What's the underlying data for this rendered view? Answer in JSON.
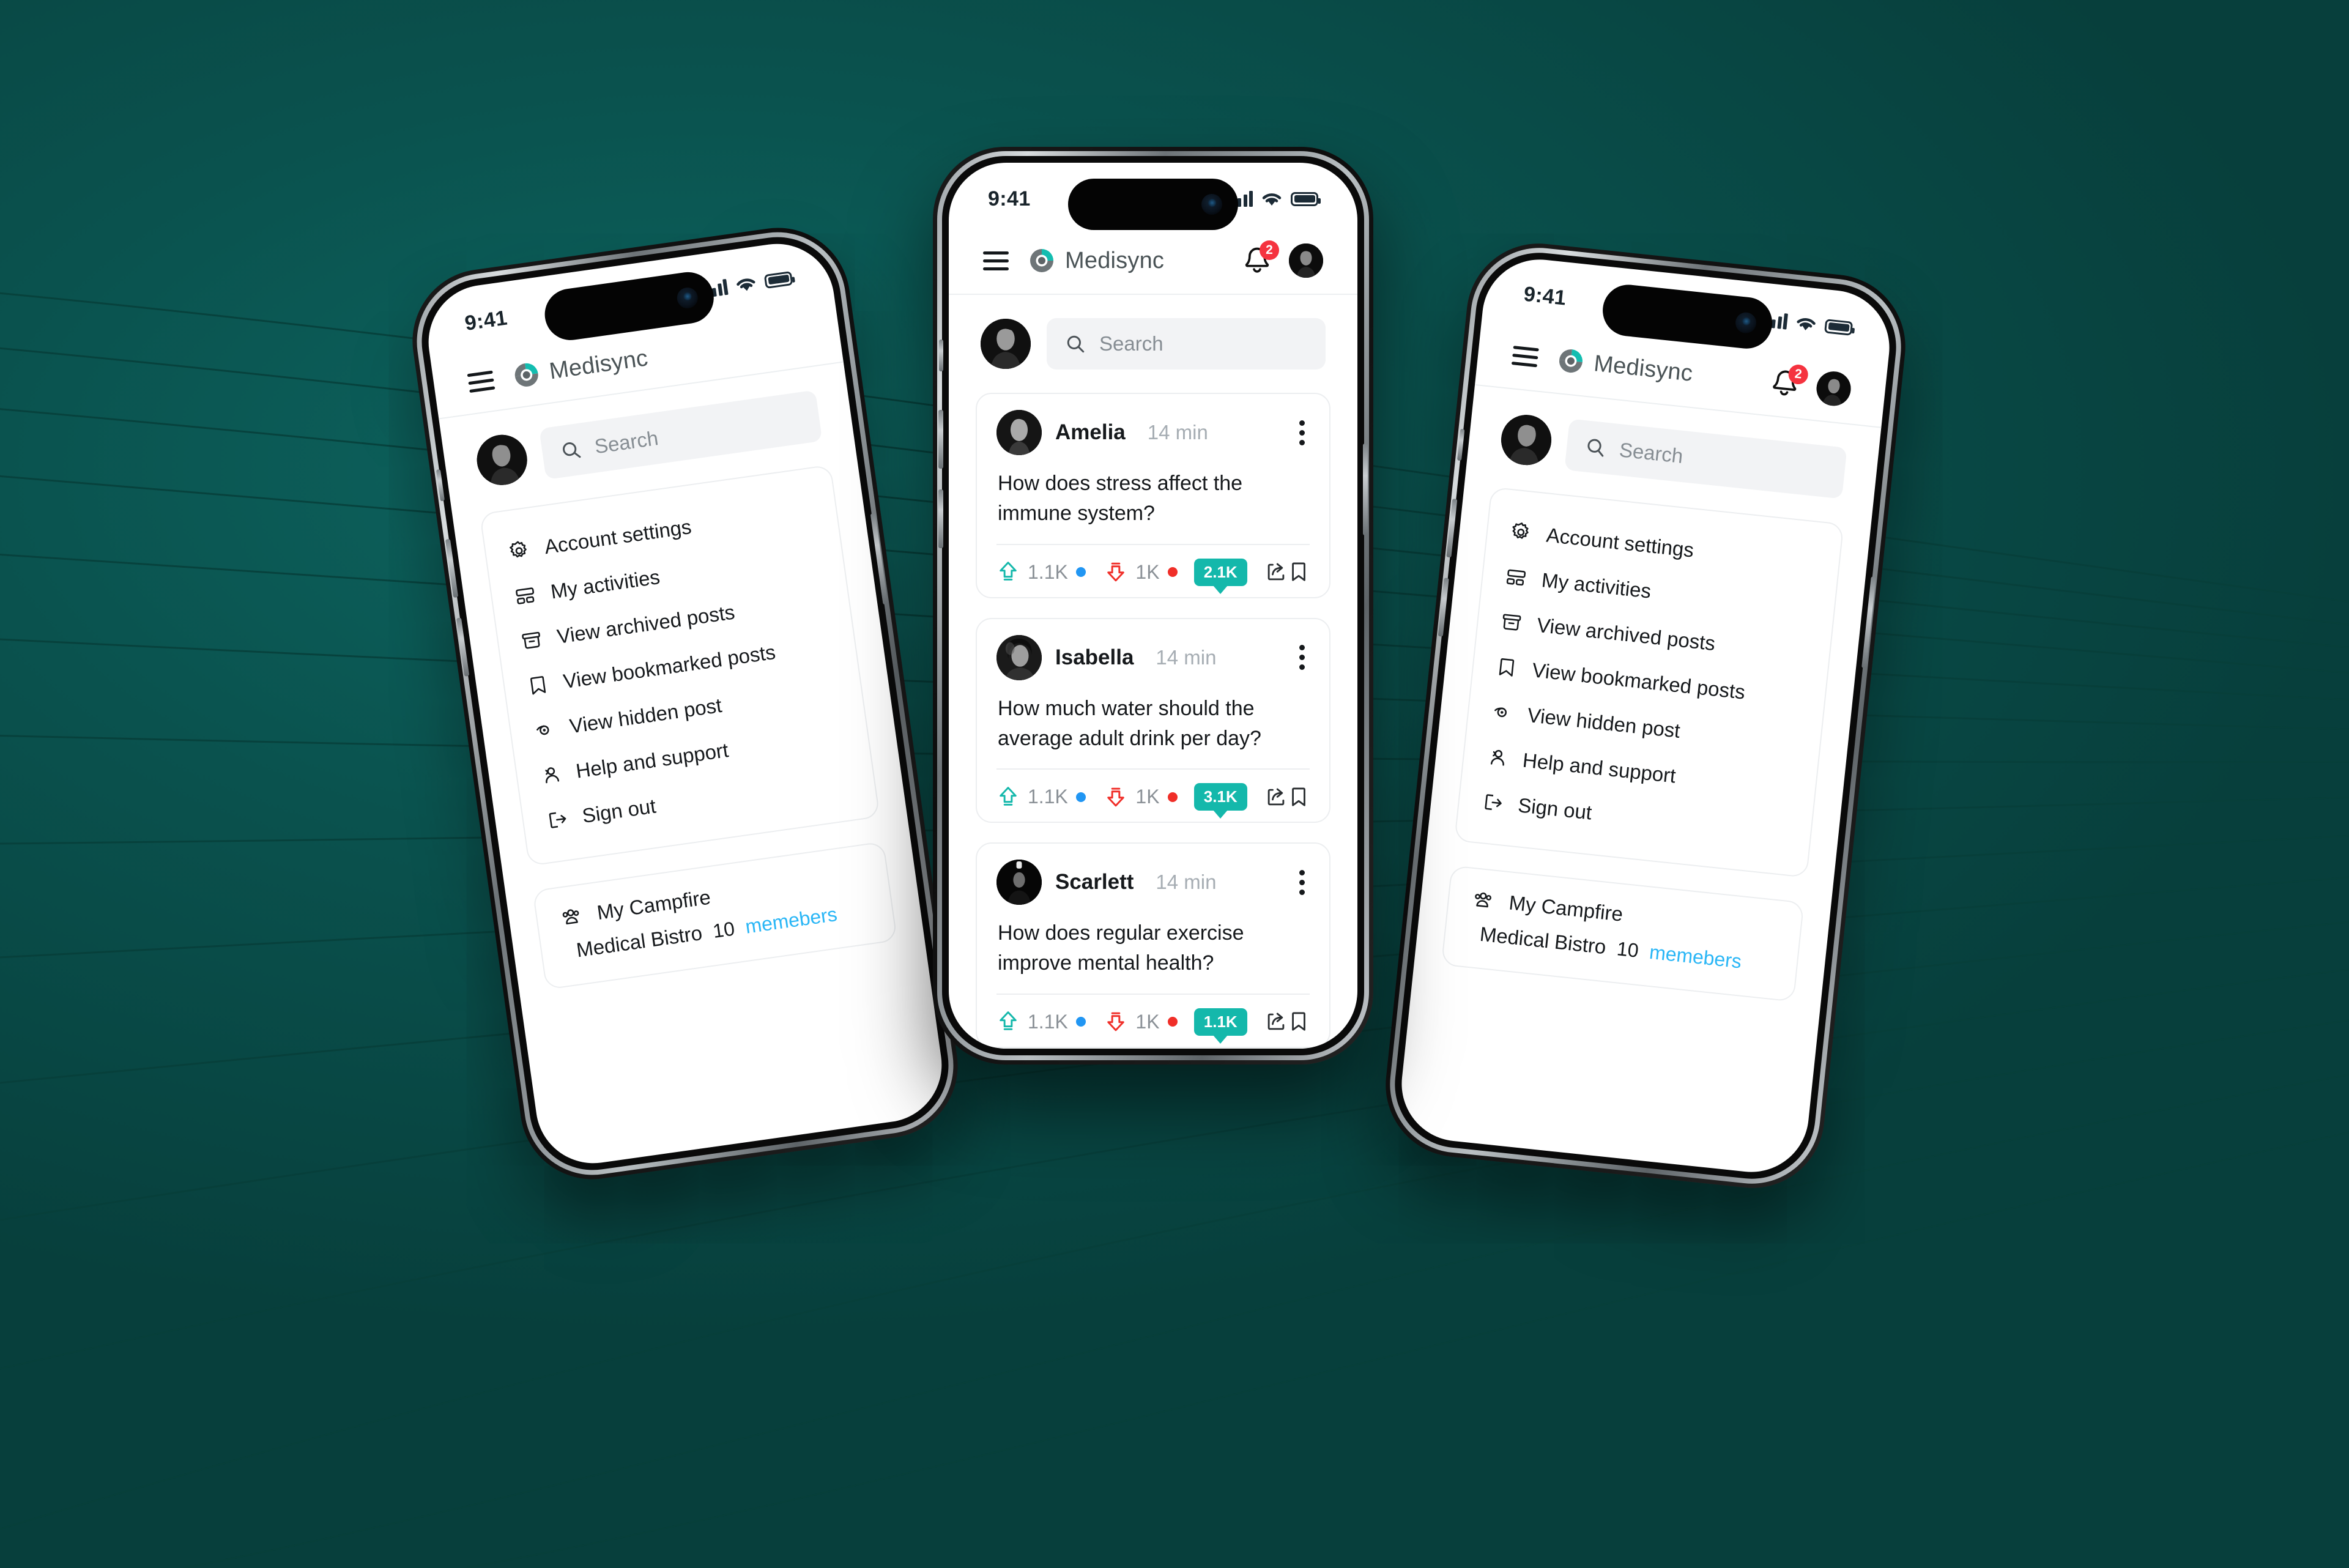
{
  "theme": {
    "background": "#0a524e",
    "accent_teal": "#14b8ab",
    "logo_teal": "#13bdb0",
    "badge_red": "#f5333f",
    "link_blue": "#29b6f6",
    "upvote_dot": "#2196f3",
    "downvote_dot": "#f02e28"
  },
  "status_bar": {
    "time": "9:41",
    "signal_icon": "cellular-signal-icon",
    "wifi_icon": "wifi-icon",
    "battery_icon": "battery-icon"
  },
  "header": {
    "menu_icon": "hamburger-menu-icon",
    "logo_icon": "medisync-logo-icon",
    "brand": "Medisync",
    "bell_icon": "notification-bell-icon",
    "notification_count": "2",
    "avatar_icon": "user-avatar"
  },
  "search": {
    "icon": "search-icon",
    "placeholder": "Search",
    "value": ""
  },
  "feed": {
    "posts": [
      {
        "author": "Amelia",
        "time": "14 min",
        "text": "How does stress affect the immune system?",
        "upvotes": "1.1K",
        "downvotes": "1K",
        "comments": "2.1K",
        "upvote_icon": "upvote-arrow-icon",
        "downvote_icon": "downvote-arrow-icon",
        "share_icon": "share-icon",
        "bookmark_icon": "bookmark-icon",
        "more_icon": "more-options-icon"
      },
      {
        "author": "Isabella",
        "time": "14 min",
        "text": "How much water should the average adult drink per day?",
        "upvotes": "1.1K",
        "downvotes": "1K",
        "comments": "3.1K",
        "upvote_icon": "upvote-arrow-icon",
        "downvote_icon": "downvote-arrow-icon",
        "share_icon": "share-icon",
        "bookmark_icon": "bookmark-icon",
        "more_icon": "more-options-icon"
      },
      {
        "author": "Scarlett",
        "time": "14 min",
        "text": "How does regular exercise improve mental health?",
        "upvotes": "1.1K",
        "downvotes": "1K",
        "comments": "1.1K",
        "upvote_icon": "upvote-arrow-icon",
        "downvote_icon": "downvote-arrow-icon",
        "share_icon": "share-icon",
        "bookmark_icon": "bookmark-icon",
        "more_icon": "more-options-icon"
      }
    ]
  },
  "side_menu": {
    "items": [
      {
        "label": "Account settings",
        "icon": "gear-icon"
      },
      {
        "label": "My activities",
        "icon": "activities-icon"
      },
      {
        "label": "View archived posts",
        "icon": "archive-icon"
      },
      {
        "label": "View bookmarked posts",
        "icon": "bookmark-icon"
      },
      {
        "label": "View hidden post",
        "icon": "eye-hidden-icon"
      },
      {
        "label": "Help and support",
        "icon": "support-person-icon"
      },
      {
        "label": "Sign out",
        "icon": "sign-out-icon"
      }
    ]
  },
  "campfire": {
    "icon": "group-people-icon",
    "title": "My Campfire",
    "group_name": "Medical Bistro",
    "member_count": "10",
    "members_label": "memebers"
  }
}
